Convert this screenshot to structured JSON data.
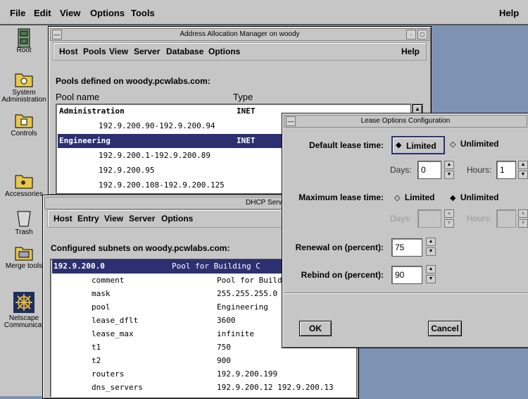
{
  "menubar": {
    "file": "File",
    "edit": "Edit",
    "view": "View",
    "options": "Options",
    "tools": "Tools",
    "help": "Help"
  },
  "desktop": {
    "icons": [
      {
        "name": "root-icon",
        "label": "Root"
      },
      {
        "name": "system-administration-icon",
        "label": "System Administration"
      },
      {
        "name": "controls-icon",
        "label": "Controls"
      },
      {
        "name": "accessories-icon",
        "label": "Accessories"
      },
      {
        "name": "trash-icon",
        "label": "Trash"
      },
      {
        "name": "merge-tools-icon",
        "label": "Merge tools"
      },
      {
        "name": "netscape-icon",
        "label": "Netscape Communicat"
      }
    ]
  },
  "address_manager": {
    "title": "Address Allocation Manager on woody",
    "menu": {
      "host": "Host",
      "pools": "Pools",
      "view": "View",
      "server": "Server",
      "database": "Database",
      "options": "Options",
      "help": "Help"
    },
    "pools_heading": "Pools defined on woody.pcwlabs.com:",
    "col_pool": "Pool name",
    "col_type": "Type",
    "rows": [
      {
        "name": "Administration",
        "type": "INET"
      },
      {
        "name": "192.9.200.90-192.9.200.94",
        "type": ""
      },
      {
        "name": "Engineering",
        "type": "INET"
      },
      {
        "name": "192.9.200.1-192.9.200.89",
        "type": ""
      },
      {
        "name": "192.9.200.95",
        "type": ""
      },
      {
        "name": "192.9.200.108-192.9.200.125",
        "type": ""
      }
    ]
  },
  "dhcp": {
    "title": "DHCP Serve",
    "menu": {
      "host": "Host",
      "entry": "Entry",
      "view": "View",
      "server": "Server",
      "options": "Options"
    },
    "subnets_heading": "Configured subnets on woody.pcwlabs.com:",
    "subnet": {
      "address": "192.9.200.0",
      "description": "Pool for Building C"
    },
    "entries": [
      {
        "key": "comment",
        "value": "Pool for Build"
      },
      {
        "key": "mask",
        "value": "255.255.255.0"
      },
      {
        "key": "pool",
        "value": "Engineering"
      },
      {
        "key": "lease_dflt",
        "value": "3600"
      },
      {
        "key": "lease_max",
        "value": "infinite"
      },
      {
        "key": "t1",
        "value": "750"
      },
      {
        "key": "t2",
        "value": "900"
      },
      {
        "key": "routers",
        "value": "192.9.200.199"
      },
      {
        "key": "dns_servers",
        "value": "192.9.200.12 192.9.200.13"
      }
    ]
  },
  "lease_dialog": {
    "title": "Lease Options Configuration",
    "default_label": "Default lease time:",
    "limited": "Limited",
    "unlimited": "Unlimited",
    "days_label": "Days:",
    "hours_label": "Hours:",
    "default_days": "0",
    "default_hours": "1",
    "max_label": "Maximum lease time:",
    "max_days_label": "Days:",
    "max_hours_label": "Hours:",
    "renewal_label": "Renewal on (percent):",
    "renewal_value": "75",
    "rebind_label": "Rebind on (percent):",
    "rebind_value": "90",
    "ok": "OK",
    "cancel": "Cancel"
  }
}
